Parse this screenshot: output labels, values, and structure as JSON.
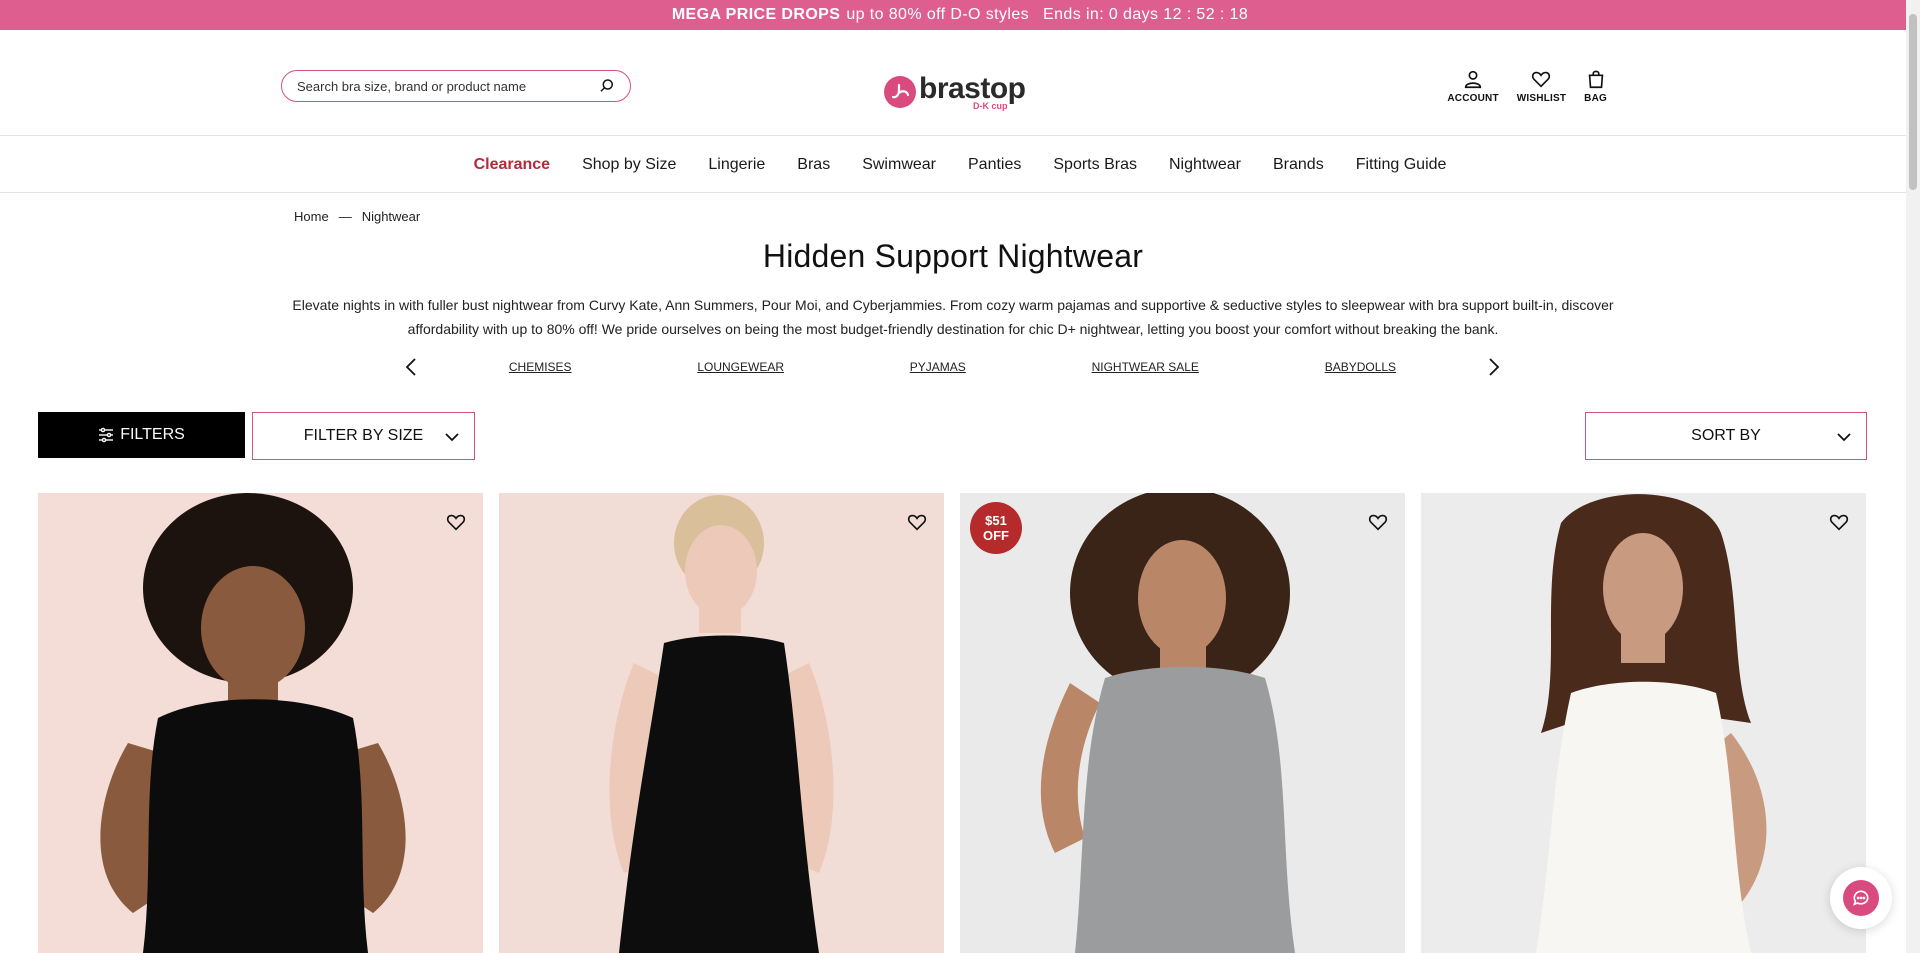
{
  "promo": {
    "headline": "MEGA PRICE DROPS",
    "text": "up to 80% off D-O styles",
    "countdown": "Ends in: 0 days 12 : 52 : 18"
  },
  "header": {
    "search_placeholder": "Search bra size, brand or product name",
    "logo_text": "brastop",
    "logo_sub": "D-K cup",
    "account_label": "ACCOUNT",
    "wishlist_label": "WISHLIST",
    "bag_label": "BAG"
  },
  "nav": {
    "items": [
      {
        "label": "Clearance"
      },
      {
        "label": "Shop by Size"
      },
      {
        "label": "Lingerie"
      },
      {
        "label": "Bras"
      },
      {
        "label": "Swimwear"
      },
      {
        "label": "Panties"
      },
      {
        "label": "Sports Bras"
      },
      {
        "label": "Nightwear"
      },
      {
        "label": "Brands"
      },
      {
        "label": "Fitting Guide"
      }
    ]
  },
  "breadcrumb": {
    "home": "Home",
    "separator": "—",
    "current": "Nightwear"
  },
  "page": {
    "title": "Hidden Support Nightwear",
    "description": "Elevate nights in with fuller bust nightwear from Curvy Kate, Ann Summers, Pour Moi, and Cyberjammies. From cozy warm pajamas and supportive & seductive styles to sleepwear with bra support built-in, discover affordability with up to 80% off! We pride ourselves on being the most budget-friendly destination for chic D+ nightwear, letting you boost your comfort without breaking the bank."
  },
  "categories": {
    "items": [
      {
        "label": "CHEMISES"
      },
      {
        "label": "LOUNGEWEAR"
      },
      {
        "label": "PYJAMAS"
      },
      {
        "label": "NIGHTWEAR SALE"
      },
      {
        "label": "BABYDOLLS"
      }
    ]
  },
  "toolbar": {
    "filters_label": "FILTERS",
    "size_filter_label": "FILTER BY SIZE",
    "sort_label": "SORT BY"
  },
  "products": [
    {
      "bg": "#f3ddd6",
      "garment": "#0c0c0c",
      "skin": "#8a5a3f",
      "hair": "#1c130f"
    },
    {
      "bg": "#f1dcd6",
      "garment": "#0d0d0d",
      "skin": "#ecc9b8",
      "hair": "#d9bf9a"
    },
    {
      "bg": "#eaeaea",
      "garment": "#9a9c9e",
      "skin": "#b98668",
      "hair": "#3a2418",
      "badge_line1": "$51",
      "badge_line2": "OFF"
    },
    {
      "bg": "#ececec",
      "garment": "#f7f6f2",
      "skin": "#c89a80",
      "hair": "#4a2a1a"
    }
  ],
  "colors": {
    "promo_bg": "#dd5e8f",
    "brand_pink": "#d94a7e",
    "clearance_red": "#b52a3a",
    "badge_red": "#b52a2a"
  }
}
